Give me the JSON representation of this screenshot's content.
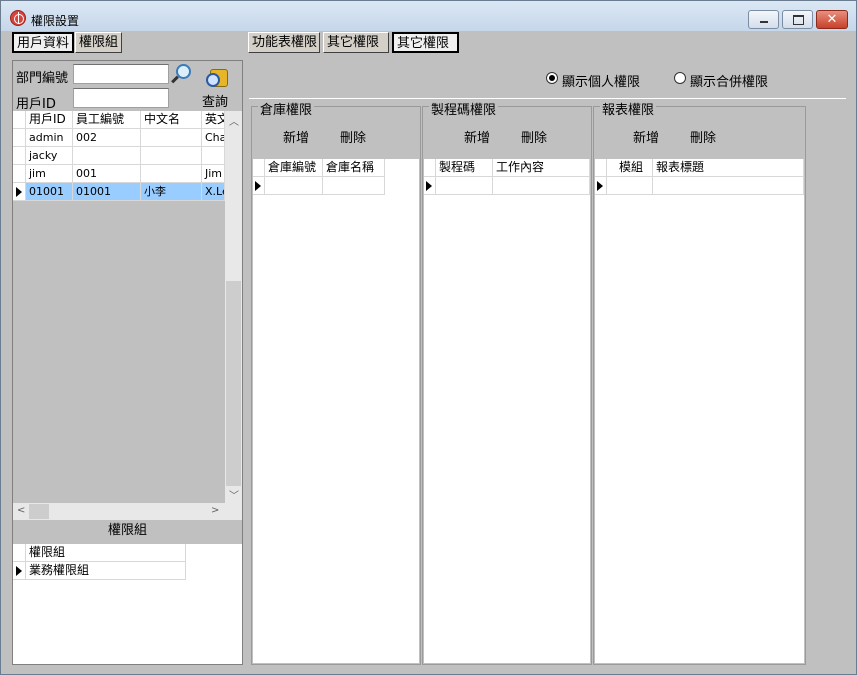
{
  "window": {
    "title": "權限設置"
  },
  "tabs_left": [
    "用戶資料",
    "權限組"
  ],
  "tabs_right": [
    "功能表權限",
    "其它權限",
    "其它權限"
  ],
  "search": {
    "dept_label": "部門編號",
    "user_label": "用戶ID",
    "query_label": "查詢",
    "dept_value": "",
    "user_value": ""
  },
  "user_grid": {
    "columns": [
      "用戶ID",
      "員工編號",
      "中文名",
      "英文"
    ],
    "rows": [
      [
        "admin",
        "002",
        "",
        "Cha"
      ],
      [
        "jacky",
        "",
        "",
        ""
      ],
      [
        "jim",
        "001",
        "",
        "Jim"
      ],
      [
        "01001",
        "01001",
        "小李",
        "X.Le"
      ]
    ]
  },
  "group": {
    "header": "權限組",
    "items": [
      "權限組",
      "業務權限組"
    ]
  },
  "radios": {
    "personal": "顯示個人權限",
    "merged": "顯示合併權限"
  },
  "panels": [
    {
      "title": "倉庫權限",
      "add": "新增",
      "del": "刪除",
      "cols": [
        "倉庫編號",
        "倉庫名稱"
      ]
    },
    {
      "title": "製程碼權限",
      "add": "新增",
      "del": "刪除",
      "cols": [
        "製程碼",
        "工作內容"
      ]
    },
    {
      "title": "報表權限",
      "add": "新增",
      "del": "刪除",
      "cols": [
        "模組",
        "報表標題"
      ]
    }
  ],
  "colors": {
    "selected_row": "#99ccff",
    "window_bg": "#c0c0c0"
  }
}
